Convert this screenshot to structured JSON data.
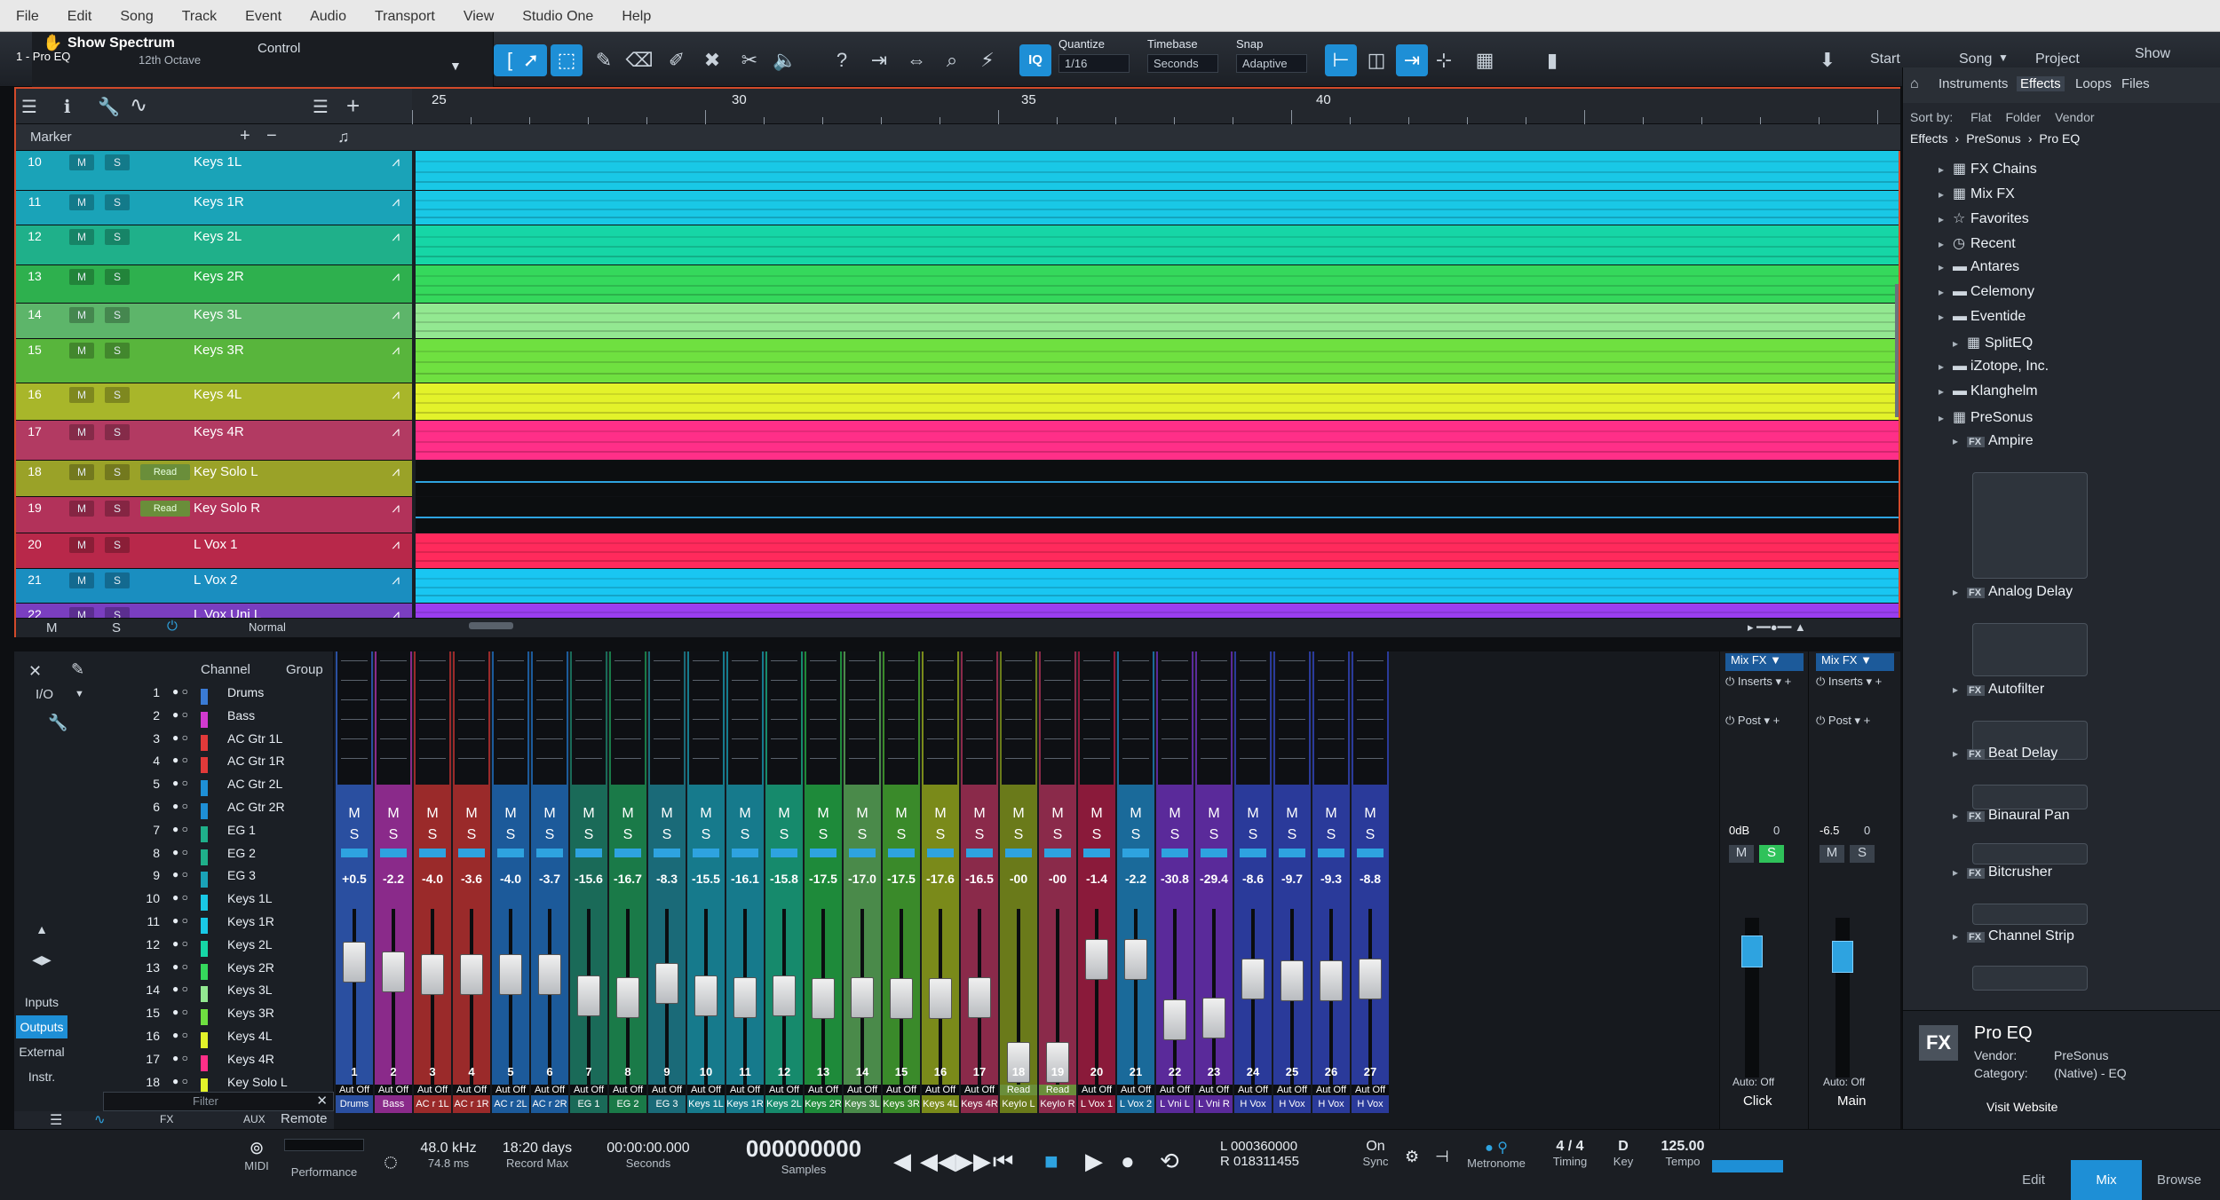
{
  "menu": [
    "File",
    "Edit",
    "Song",
    "Track",
    "Event",
    "Audio",
    "Transport",
    "View",
    "Studio One",
    "Help"
  ],
  "toolbar": {
    "show_spectrum": "Show Spectrum",
    "plugin_name": "1 - Pro EQ",
    "octave": "12th Octave",
    "control": "Control",
    "quantize_label": "Quantize",
    "quantize_value": "1/16",
    "timebase_label": "Timebase",
    "timebase_value": "Seconds",
    "snap_label": "Snap",
    "snap_value": "Adaptive",
    "iq": "IQ",
    "start": "Start",
    "song": "Song",
    "project": "Project",
    "show": "Show"
  },
  "ruler": {
    "marks": [
      "25",
      "30",
      "35",
      "40"
    ]
  },
  "arrange": {
    "marker_label": "Marker",
    "tracks": [
      {
        "num": "10",
        "name": "Keys 1L",
        "color": "#1aa3b8",
        "lane": "#19c8e6"
      },
      {
        "num": "11",
        "name": "Keys 1R",
        "color": "#1aa3b8",
        "lane": "#19c8e6"
      },
      {
        "num": "12",
        "name": "Keys 2L",
        "color": "#1fb08a",
        "lane": "#16d6a6"
      },
      {
        "num": "13",
        "name": "Keys 2R",
        "color": "#2eb04e",
        "lane": "#35d85c"
      },
      {
        "num": "14",
        "name": "Keys 3L",
        "color": "#5db56a",
        "lane": "#93e891"
      },
      {
        "num": "15",
        "name": "Keys 3R",
        "color": "#58b53c",
        "lane": "#6fe040"
      },
      {
        "num": "16",
        "name": "Keys 4L",
        "color": "#a8b62a",
        "lane": "#e3f22a"
      },
      {
        "num": "17",
        "name": "Keys 4R",
        "color": "#b23a62",
        "lane": "#ff2f88"
      },
      {
        "num": "18",
        "name": "Key Solo L",
        "color": "#9aa228",
        "lane": "#0c0e10",
        "read": "Read"
      },
      {
        "num": "19",
        "name": "Key Solo R",
        "color": "#b2325a",
        "lane": "#0c0e10",
        "read": "Read"
      },
      {
        "num": "20",
        "name": "L Vox 1",
        "color": "#b8284a",
        "lane": "#ff2a5c"
      },
      {
        "num": "21",
        "name": "L Vox 2",
        "color": "#1a8ec0",
        "lane": "#19c6f2"
      },
      {
        "num": "22",
        "name": "L Vox Uni L",
        "color": "#7a3ec0",
        "lane": "#9a3ef0"
      }
    ],
    "footer_m": "M",
    "footer_s": "S",
    "footer_normal": "Normal"
  },
  "console": {
    "header_channel": "Channel",
    "header_group": "Group",
    "io_label": "I/O",
    "filter_placeholder": "Filter",
    "side": [
      "Inputs",
      "Outputs",
      "External",
      "Instr."
    ],
    "active_side": "Outputs",
    "remote": "Remote",
    "aux": "AUX",
    "fx": "FX",
    "channels": [
      {
        "n": "1",
        "name": "Drums",
        "color": "#3a7bd5"
      },
      {
        "n": "2",
        "name": "Bass",
        "color": "#d23ad0"
      },
      {
        "n": "3",
        "name": "AC Gtr 1L",
        "color": "#e23a3a"
      },
      {
        "n": "4",
        "name": "AC Gtr 1R",
        "color": "#e23a3a"
      },
      {
        "n": "5",
        "name": "AC Gtr 2L",
        "color": "#1e8fd6"
      },
      {
        "n": "6",
        "name": "AC Gtr 2R",
        "color": "#1e8fd6"
      },
      {
        "n": "7",
        "name": "EG 1",
        "color": "#1fb08a"
      },
      {
        "n": "8",
        "name": "EG 2",
        "color": "#1fb08a"
      },
      {
        "n": "9",
        "name": "EG 3",
        "color": "#1aa3b8"
      },
      {
        "n": "10",
        "name": "Keys 1L",
        "color": "#19c8e6"
      },
      {
        "n": "11",
        "name": "Keys 1R",
        "color": "#19c8e6"
      },
      {
        "n": "12",
        "name": "Keys 2L",
        "color": "#16d6a6"
      },
      {
        "n": "13",
        "name": "Keys 2R",
        "color": "#35d85c"
      },
      {
        "n": "14",
        "name": "Keys 3L",
        "color": "#93e891"
      },
      {
        "n": "15",
        "name": "Keys 3R",
        "color": "#6fe040"
      },
      {
        "n": "16",
        "name": "Keys 4L",
        "color": "#e3f22a"
      },
      {
        "n": "17",
        "name": "Keys 4R",
        "color": "#ff2f88"
      },
      {
        "n": "18",
        "name": "Key Solo L",
        "color": "#e3f22a"
      }
    ],
    "strips": [
      {
        "vol": "+0.5",
        "num": "1",
        "lbl": "Drums",
        "color": "#2a4fa0",
        "fader": 0.78
      },
      {
        "vol": "-2.2",
        "num": "2",
        "lbl": "Bass",
        "color": "#8a2a8a",
        "fader": 0.72
      },
      {
        "vol": "-4.0",
        "num": "3",
        "lbl": "AC r 1L",
        "color": "#9a2a2a",
        "fader": 0.7
      },
      {
        "vol": "-3.6",
        "num": "4",
        "lbl": "AC r 1R",
        "color": "#9a2a2a",
        "fader": 0.7
      },
      {
        "vol": "-4.0",
        "num": "5",
        "lbl": "AC r 2L",
        "color": "#1c5a9a",
        "fader": 0.7
      },
      {
        "vol": "-3.7",
        "num": "6",
        "lbl": "AC r 2R",
        "color": "#1c5a9a",
        "fader": 0.7
      },
      {
        "vol": "-15.6",
        "num": "7",
        "lbl": "EG 1",
        "color": "#1a6a58",
        "fader": 0.56
      },
      {
        "vol": "-16.7",
        "num": "8",
        "lbl": "EG 2",
        "color": "#1a7a48",
        "fader": 0.55
      },
      {
        "vol": "-8.3",
        "num": "9",
        "lbl": "EG 3",
        "color": "#1a6a78",
        "fader": 0.64
      },
      {
        "vol": "-15.5",
        "num": "10",
        "lbl": "Keys 1L",
        "color": "#167a8c",
        "fader": 0.56
      },
      {
        "vol": "-16.1",
        "num": "11",
        "lbl": "Keys 1R",
        "color": "#167a8c",
        "fader": 0.55
      },
      {
        "vol": "-15.8",
        "num": "12",
        "lbl": "Keys 2L",
        "color": "#168a6c",
        "fader": 0.56
      },
      {
        "vol": "-17.5",
        "num": "13",
        "lbl": "Keys 2R",
        "color": "#1e8a3a",
        "fader": 0.54
      },
      {
        "vol": "-17.0",
        "num": "14",
        "lbl": "Keys 3L",
        "color": "#4a8a4a",
        "fader": 0.55
      },
      {
        "vol": "-17.5",
        "num": "15",
        "lbl": "Keys 3R",
        "color": "#3a8a2a",
        "fader": 0.54
      },
      {
        "vol": "-17.6",
        "num": "16",
        "lbl": "Keys 4L",
        "color": "#7a8a1a",
        "fader": 0.54
      },
      {
        "vol": "-16.5",
        "num": "17",
        "lbl": "Keys 4R",
        "color": "#8a2a4a",
        "fader": 0.55
      },
      {
        "vol": "-00",
        "num": "18",
        "lbl": "KeyIo L",
        "color": "#6a7a1a",
        "fader": 0.12,
        "read": "Read"
      },
      {
        "vol": "-00",
        "num": "19",
        "lbl": "KeyIo R",
        "color": "#8a2a4a",
        "fader": 0.12,
        "read": "Read"
      },
      {
        "vol": "-1.4",
        "num": "20",
        "lbl": "L Vox 1",
        "color": "#8a1a3a",
        "fader": 0.8
      },
      {
        "vol": "-2.2",
        "num": "21",
        "lbl": "L Vox 2",
        "color": "#1a6a9a",
        "fader": 0.8
      },
      {
        "vol": "-30.8",
        "num": "22",
        "lbl": "L Vni L",
        "color": "#5a2a9a",
        "fader": 0.4
      },
      {
        "vol": "-29.4",
        "num": "23",
        "lbl": "L Vni R",
        "color": "#5a2a9a",
        "fader": 0.41
      },
      {
        "vol": "-8.6",
        "num": "24",
        "lbl": "H Vox",
        "color": "#2a3a9a",
        "fader": 0.67
      },
      {
        "vol": "-9.7",
        "num": "25",
        "lbl": "H Vox",
        "color": "#2a3a9a",
        "fader": 0.66
      },
      {
        "vol": "-9.3",
        "num": "26",
        "lbl": "H Vox",
        "color": "#2a3a9a",
        "fader": 0.66
      },
      {
        "vol": "-8.8",
        "num": "27",
        "lbl": "H Vox",
        "color": "#2a3a9a",
        "fader": 0.67
      }
    ],
    "auto_off": "Aut Off",
    "read_label": "Read"
  },
  "mixfx": {
    "left_title": "Mix FX",
    "right_title": "Mix FX",
    "inserts": "Inserts",
    "post": "Post",
    "left_vol": "0dB",
    "left_pan": "0",
    "right_vol": "-6.5",
    "right_pan": "0",
    "left_auto": "Auto: Off",
    "right_auto": "Auto: Off",
    "left_name": "Click",
    "right_name": "Main"
  },
  "browser": {
    "tabs": [
      "Instruments",
      "Effects",
      "Loops",
      "Files"
    ],
    "active_tab": "Effects",
    "sort_by": "Sort by:",
    "sort_opts": [
      "Flat",
      "Folder",
      "Vendor"
    ],
    "breadcrumb": [
      "Effects",
      "PreSonus",
      "Pro EQ"
    ],
    "items": [
      {
        "label": "FX Chains",
        "icon": "▦"
      },
      {
        "label": "Mix FX",
        "icon": "▦"
      },
      {
        "label": "Favorites",
        "icon": "☆"
      },
      {
        "label": "Recent",
        "icon": "◷"
      },
      {
        "label": "Antares",
        "icon": "▬"
      },
      {
        "label": "Celemony",
        "icon": "▬"
      },
      {
        "label": "Eventide",
        "icon": "▬"
      },
      {
        "label": "SplitEQ",
        "icon": "▦"
      },
      {
        "label": "iZotope, Inc.",
        "icon": "▬"
      },
      {
        "label": "Klanghelm",
        "icon": "▬"
      },
      {
        "label": "PreSonus",
        "icon": "▦"
      },
      {
        "label": "Ampire",
        "icon": "FX"
      },
      {
        "label": "Analog Delay",
        "icon": "FX"
      },
      {
        "label": "Autofilter",
        "icon": "FX"
      },
      {
        "label": "Beat Delay",
        "icon": "FX"
      },
      {
        "label": "Binaural Pan",
        "icon": "FX"
      },
      {
        "label": "Bitcrusher",
        "icon": "FX"
      },
      {
        "label": "Channel Strip",
        "icon": "FX"
      }
    ],
    "info_title": "Pro EQ",
    "info_vendor_label": "Vendor:",
    "info_vendor": "PreSonus",
    "info_category_label": "Category:",
    "info_category": "(Native) - EQ",
    "visit": "Visit Website",
    "bottom_tabs": [
      "Edit",
      "Mix",
      "Browse"
    ]
  },
  "transport": {
    "midi": "MIDI",
    "performance": "Performance",
    "sample_rate": "48.0 kHz",
    "latency": "74.8 ms",
    "record_days": "18:20 days",
    "record_max": "Record Max",
    "time": "00:00:00.000",
    "time_unit": "Seconds",
    "samples": "000000000",
    "samples_unit": "Samples",
    "loop_l": "L  000360000",
    "loop_r": "R  018311455",
    "sync_on": "On",
    "sync": "Sync",
    "metronome": "Metronome",
    "timing_val": "4 / 4",
    "timing": "Timing",
    "key_val": "D",
    "key": "Key",
    "tempo_val": "125.00",
    "tempo": "Tempo"
  }
}
